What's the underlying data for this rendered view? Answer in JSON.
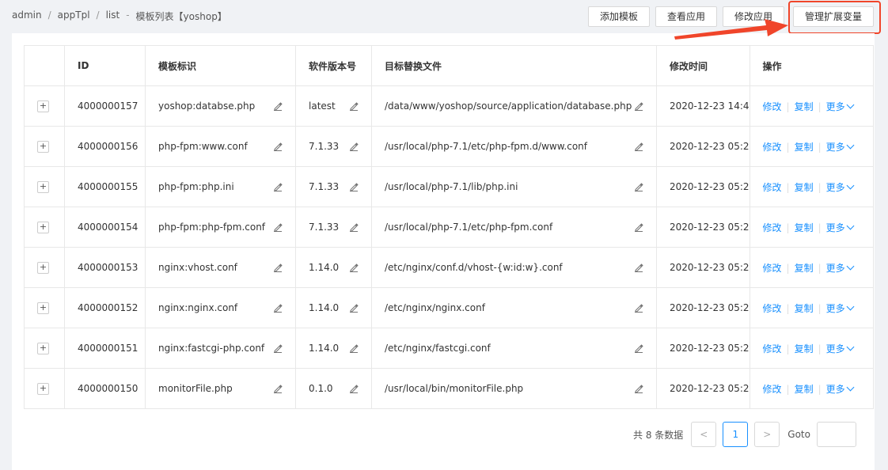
{
  "breadcrumb": [
    "admin",
    "appTpl",
    "list",
    "模板列表【yoshop】"
  ],
  "toolbar": {
    "add": "添加模板",
    "view": "查看应用",
    "edit": "修改应用",
    "manage": "管理扩展变量"
  },
  "table": {
    "headers": [
      "",
      "ID",
      "模板标识",
      "软件版本号",
      "目标替换文件",
      "修改时间",
      "操作"
    ],
    "rows": [
      {
        "id": "4000000157",
        "tpl": "yoshop:databse.php",
        "ver": "latest",
        "file": "/data/www/yoshop/source/application/database.php",
        "time": "2020-12-23 14:4"
      },
      {
        "id": "4000000156",
        "tpl": "php-fpm:www.conf",
        "ver": "7.1.33",
        "file": "/usr/local/php-7.1/etc/php-fpm.d/www.conf",
        "time": "2020-12-23 05:2"
      },
      {
        "id": "4000000155",
        "tpl": "php-fpm:php.ini",
        "ver": "7.1.33",
        "file": "/usr/local/php-7.1/lib/php.ini",
        "time": "2020-12-23 05:2"
      },
      {
        "id": "4000000154",
        "tpl": "php-fpm:php-fpm.conf",
        "ver": "7.1.33",
        "file": "/usr/local/php-7.1/etc/php-fpm.conf",
        "time": "2020-12-23 05:2"
      },
      {
        "id": "4000000153",
        "tpl": "nginx:vhost.conf",
        "ver": "1.14.0",
        "file": "/etc/nginx/conf.d/vhost-{w:id:w}.conf",
        "time": "2020-12-23 05:2"
      },
      {
        "id": "4000000152",
        "tpl": "nginx:nginx.conf",
        "ver": "1.14.0",
        "file": "/etc/nginx/nginx.conf",
        "time": "2020-12-23 05:2"
      },
      {
        "id": "4000000151",
        "tpl": "nginx:fastcgi-php.conf",
        "ver": "1.14.0",
        "file": "/etc/nginx/fastcgi.conf",
        "time": "2020-12-23 05:2"
      },
      {
        "id": "4000000150",
        "tpl": "monitorFile.php",
        "ver": "0.1.0",
        "file": "/usr/local/bin/monitorFile.php",
        "time": "2020-12-23 05:2"
      }
    ],
    "ops": {
      "edit": "修改",
      "copy": "复制",
      "more": "更多"
    },
    "expand": "+"
  },
  "pager": {
    "total": "共 8 条数据",
    "prev": "<",
    "page": "1",
    "next": ">",
    "goto": "Goto"
  },
  "colors": {
    "accent": "#1890ff",
    "highlight": "#f0452a"
  }
}
